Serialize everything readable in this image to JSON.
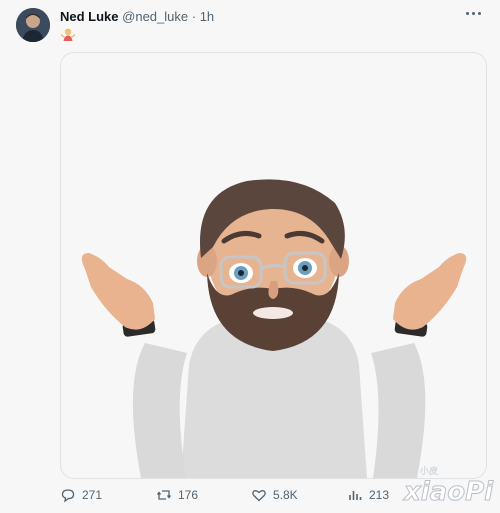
{
  "tweet": {
    "author_name": "Ned Luke",
    "author_handle": "@ned_luke",
    "separator": "·",
    "time_ago": "1h",
    "text_emoji": "person-shrugging-emoji"
  },
  "actions": {
    "replies": "271",
    "reposts": "176",
    "likes": "5.8K",
    "views": "213"
  },
  "watermark": {
    "site": "xiaoPi",
    "small_text": "小皮"
  },
  "colors": {
    "muted": "#536471",
    "card_border": "#dfe3e6",
    "background": "#f7f7f7"
  }
}
